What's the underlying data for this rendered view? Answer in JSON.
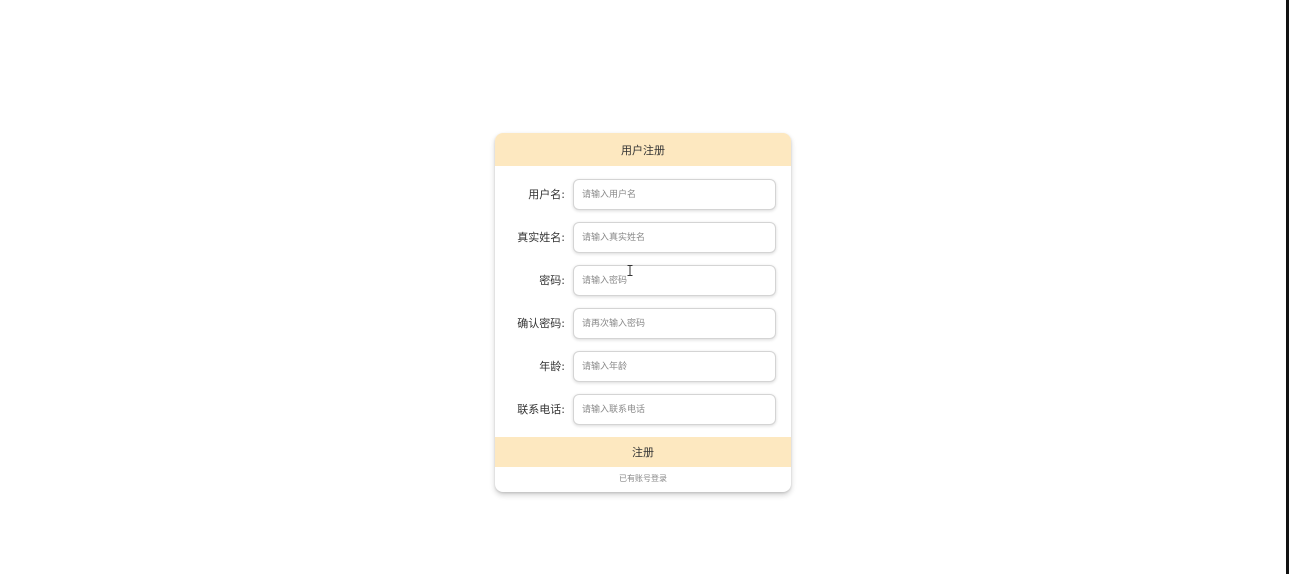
{
  "form": {
    "title": "用户注册",
    "fields": [
      {
        "label": "用户名:",
        "placeholder": "请输入用户名",
        "value": ""
      },
      {
        "label": "真实姓名:",
        "placeholder": "请输入真实姓名",
        "value": ""
      },
      {
        "label": "密码:",
        "placeholder": "请输入密码",
        "value": ""
      },
      {
        "label": "确认密码:",
        "placeholder": "请再次输入密码",
        "value": ""
      },
      {
        "label": "年龄:",
        "placeholder": "请输入年龄",
        "value": ""
      },
      {
        "label": "联系电话:",
        "placeholder": "请输入联系电话",
        "value": ""
      }
    ],
    "submit_label": "注册",
    "login_link": "已有账号登录"
  },
  "colors": {
    "header_bg": "#fde8c0",
    "button_bg": "#fde8c0"
  },
  "icons": {
    "cursor": "text-cursor-icon"
  }
}
